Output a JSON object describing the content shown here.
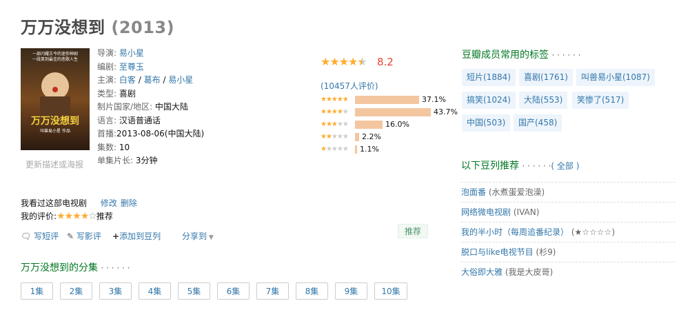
{
  "title": {
    "name": "万万没想到",
    "year": "(2013)"
  },
  "poster": {
    "alt_top_line1": "一部闪耀古今的迷你神剧",
    "alt_top_line2": "一段笑到最佳的悲歌人生",
    "brand": "万万没想到",
    "sub": "叫兽易小星 作品"
  },
  "update_link": "更新描述或海报",
  "info": {
    "director_label": "导演:",
    "director": "易小星",
    "writer_label": "编剧:",
    "writer": "至尊玉",
    "cast_label": "主演:",
    "cast": [
      "白客",
      "葛布",
      "易小星"
    ],
    "genre_label": "类型:",
    "genre": "喜剧",
    "country_label": "制片国家/地区:",
    "country": "中国大陆",
    "language_label": "语言:",
    "language": "汉语普通话",
    "premiere_label": "首播:",
    "premiere": "2013-08-06(中国大陆)",
    "episodes_label": "集数:",
    "episodes": "10",
    "duration_label": "单集片长:",
    "duration": "3分钟"
  },
  "rating": {
    "score": "8.2",
    "votes_text": "(10457人评价)",
    "stars_full": 4,
    "stars_half": 1,
    "distribution": [
      {
        "stars": 5,
        "pct_text": "37.1%",
        "pct": 37.1
      },
      {
        "stars": 4,
        "pct_text": "43.7%",
        "pct": 43.7
      },
      {
        "stars": 3,
        "pct_text": "16.0%",
        "pct": 16.0
      },
      {
        "stars": 2,
        "pct_text": "2.2%",
        "pct": 2.2
      },
      {
        "stars": 1,
        "pct_text": "1.1%",
        "pct": 1.1
      }
    ]
  },
  "watched": {
    "text": "我看过这部电视剧",
    "edit": "修改",
    "delete": "删除"
  },
  "my_rating": {
    "label": "我的评价:",
    "stars": 4,
    "comment": "推荐"
  },
  "actions": {
    "short_review": "写短评",
    "review": "写影评",
    "add_doulist": "添加到豆列",
    "share": "分享到"
  },
  "recommend_button": "推荐",
  "episodes_section": {
    "title": "万万没想到的分集",
    "dots": "· · · · · ·",
    "items": [
      "1集",
      "2集",
      "3集",
      "4集",
      "5集",
      "6集",
      "7集",
      "8集",
      "9集",
      "10集"
    ]
  },
  "tags_section": {
    "title": "豆瓣成员常用的标签",
    "dots": "· · · · · ·",
    "tags": [
      "短片(1884)",
      "喜剧(1761)",
      "叫兽易小星(1087)",
      "搞笑(1024)",
      "大陆(553)",
      "笑惨了(517)",
      "中国(503)",
      "国产(458)"
    ]
  },
  "doulist_section": {
    "title": "以下豆列推荐",
    "dots": "· · · · · ·",
    "all": "( 全部 )",
    "items": [
      {
        "name": "泡面番",
        "author": "(水煮蛋爱泡澡)"
      },
      {
        "name": "网络微电视剧",
        "author": "(IVAN)"
      },
      {
        "name": "我的半小时（每周追番纪录）",
        "author": "(★☆☆☆☆)"
      },
      {
        "name": "脱口与like电视节目",
        "author": "(杉9)"
      },
      {
        "name": "大俗即大雅",
        "author": "(我是大皮哥)"
      }
    ]
  },
  "colors": {
    "link": "#3377aa",
    "section_green": "#007722",
    "star": "#ffac2d",
    "bar": "#f4c6a0"
  }
}
